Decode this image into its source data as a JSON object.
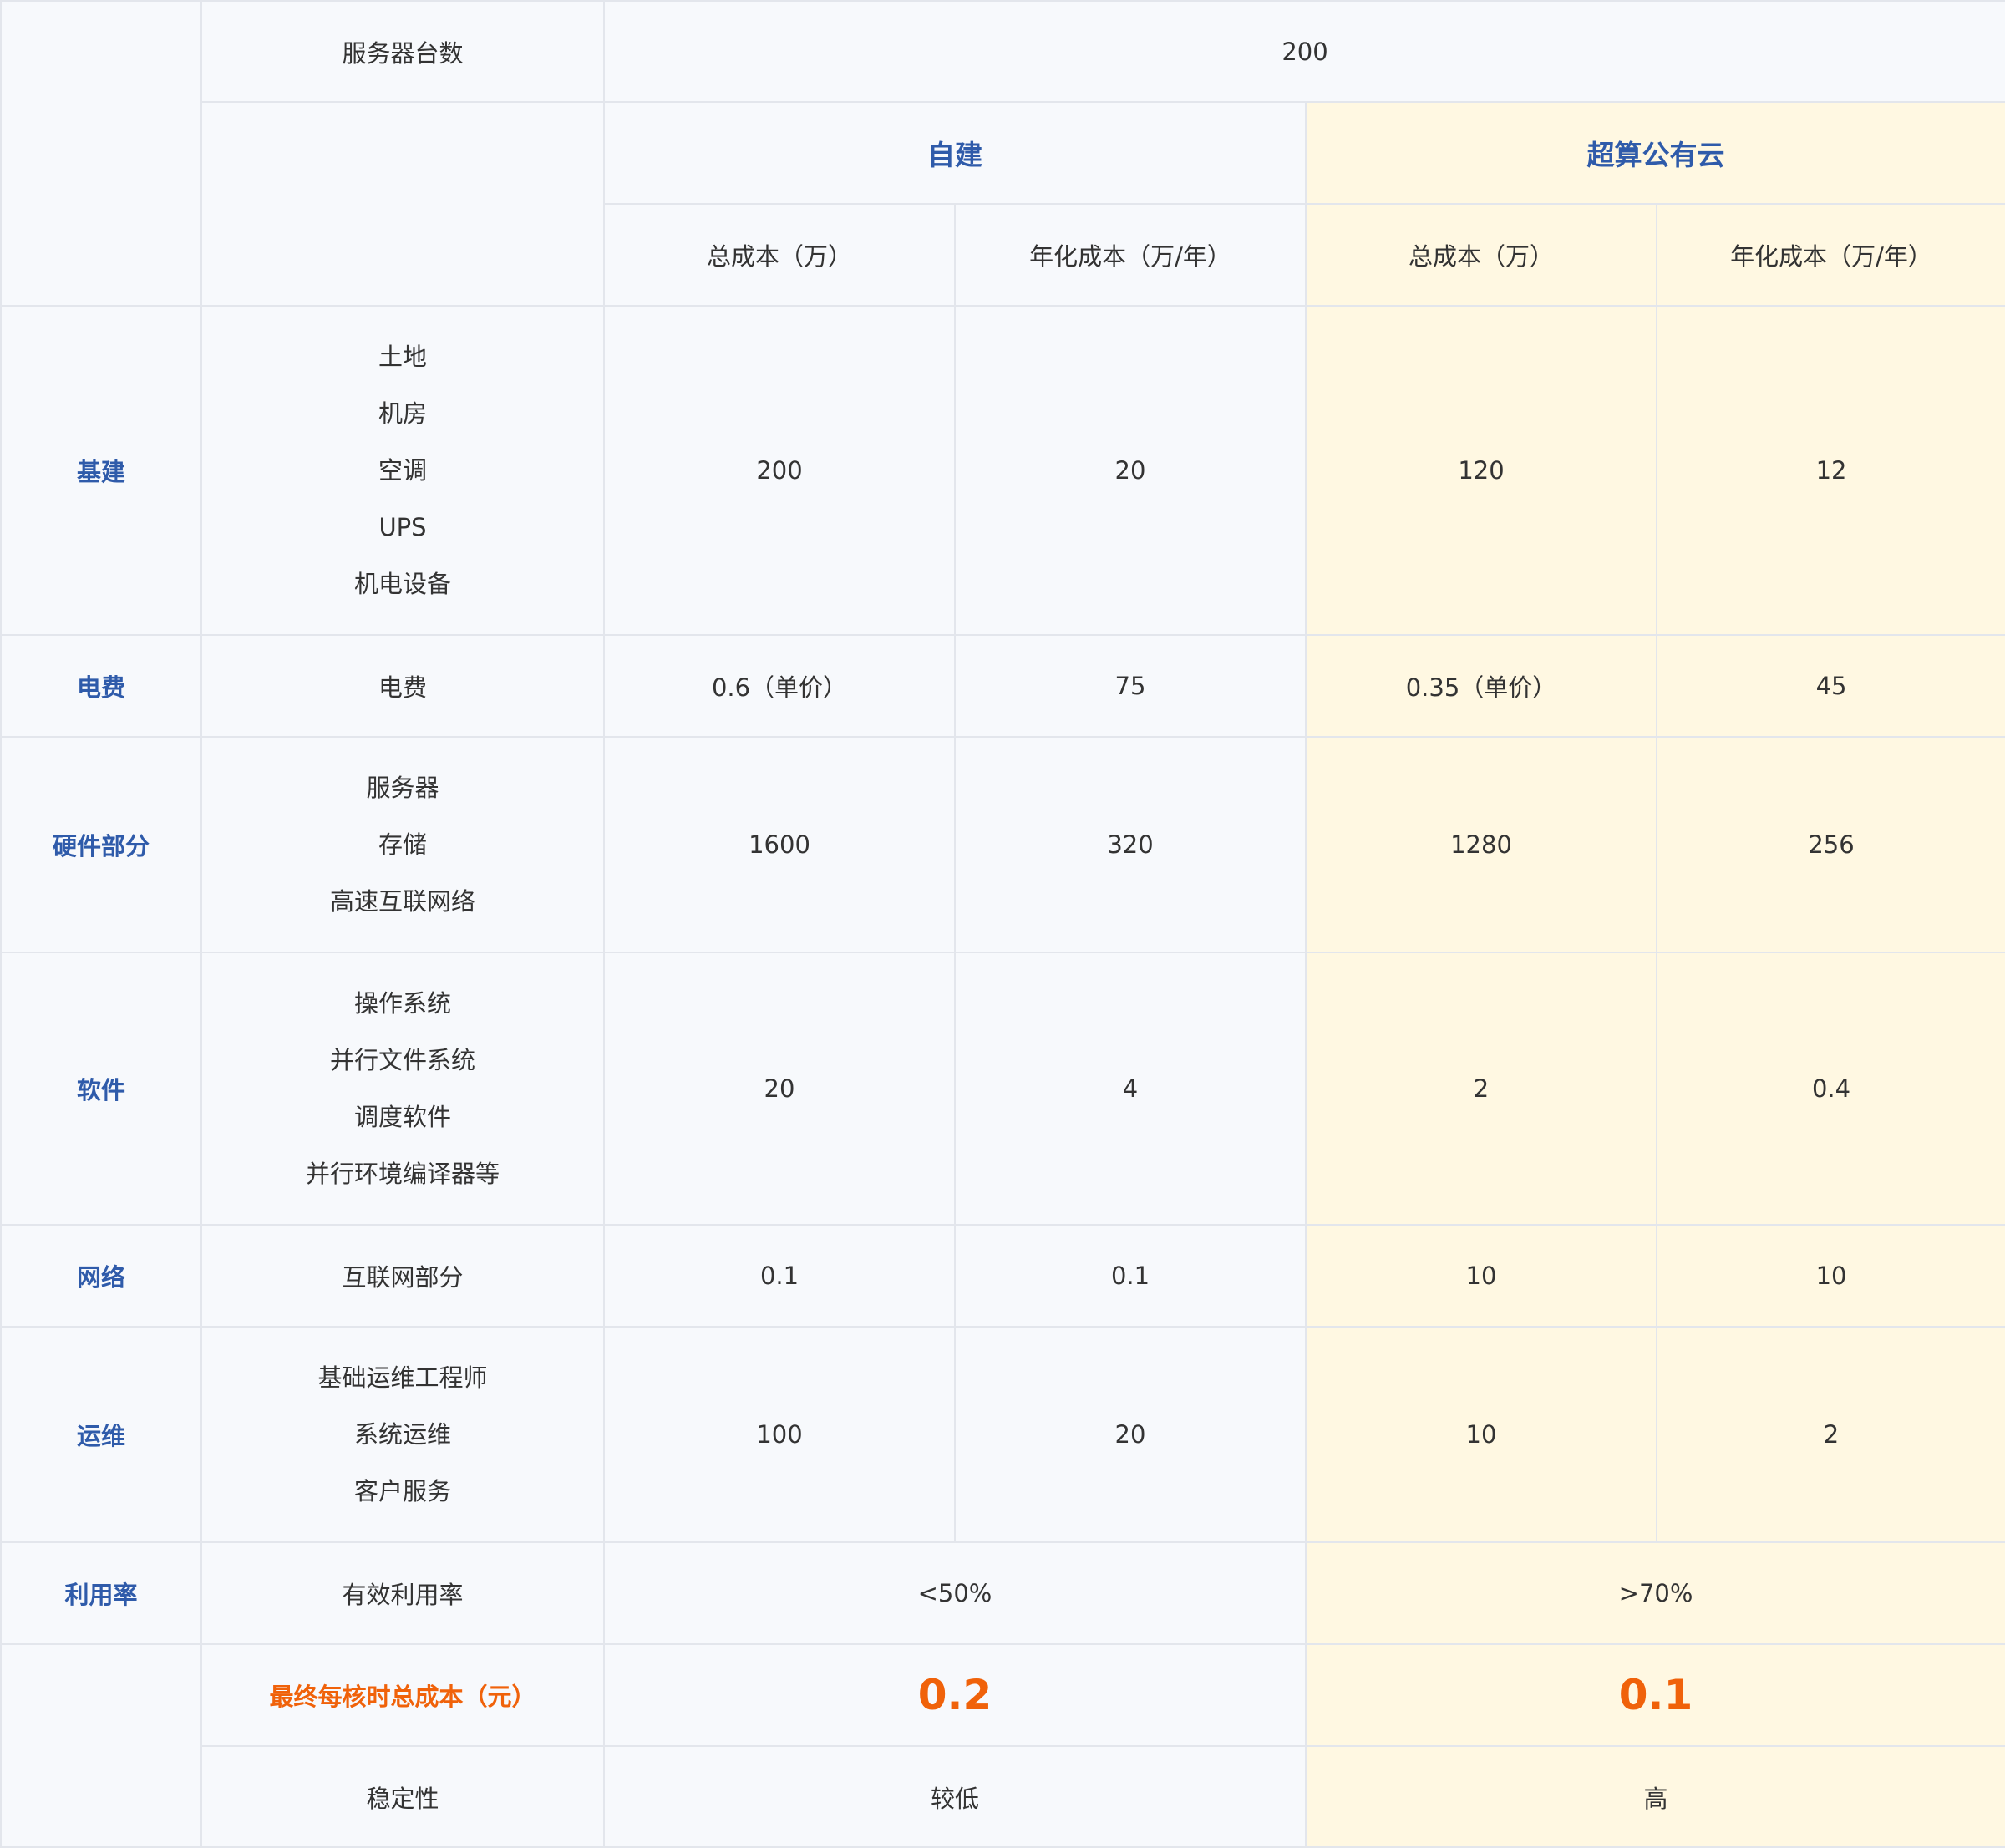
{
  "header": {
    "server_count_label": "服务器台数",
    "server_count_value": "200",
    "group_self": "自建",
    "group_cloud": "超算公有云",
    "col_total": "总成本（万）",
    "col_annual": "年化成本（万/年）"
  },
  "rows": [
    {
      "category": "基建",
      "items": [
        "土地",
        "机房",
        "空调",
        "UPS",
        "机电设备"
      ],
      "self_total": "200",
      "self_annual": "20",
      "cloud_total": "120",
      "cloud_annual": "12"
    },
    {
      "category": "电费",
      "items": [
        "电费"
      ],
      "self_total": "0.6（单价）",
      "self_annual": "75",
      "cloud_total": "0.35（单价）",
      "cloud_annual": "45"
    },
    {
      "category": "硬件部分",
      "items": [
        "服务器",
        "存储",
        "高速互联网络"
      ],
      "self_total": "1600",
      "self_annual": "320",
      "cloud_total": "1280",
      "cloud_annual": "256"
    },
    {
      "category": "软件",
      "items": [
        "操作系统",
        "并行文件系统",
        "调度软件",
        "并行环境编译器等"
      ],
      "self_total": "20",
      "self_annual": "4",
      "cloud_total": "2",
      "cloud_annual": "0.4"
    },
    {
      "category": "网络",
      "items": [
        "互联网部分"
      ],
      "self_total": "0.1",
      "self_annual": "0.1",
      "cloud_total": "10",
      "cloud_annual": "10"
    },
    {
      "category": "运维",
      "items": [
        "基础运维工程师",
        "系统运维",
        "客户服务"
      ],
      "self_total": "100",
      "self_annual": "20",
      "cloud_total": "10",
      "cloud_annual": "2"
    }
  ],
  "utilization": {
    "category": "利用率",
    "item": "有效利用率",
    "self": "<50%",
    "cloud": ">70%"
  },
  "final": {
    "label": "最终每核时总成本（元）",
    "self": "0.2",
    "cloud": "0.1"
  },
  "stability": {
    "label": "稳定性",
    "self": "较低",
    "cloud": "高"
  },
  "colors": {
    "category_text": "#2f5baa",
    "accent": "#f0620a",
    "cloud_bg": "#fff8e2",
    "base_bg": "#f7f9fc",
    "border": "#e3e6ec"
  }
}
